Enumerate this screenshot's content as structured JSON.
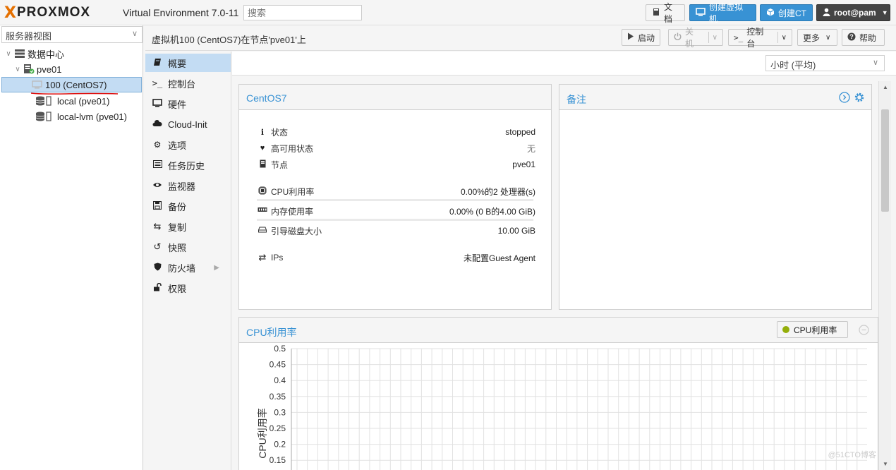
{
  "app": {
    "logo_x": "X",
    "logo_text": "PROXMOX",
    "version": "Virtual Environment 7.0-11",
    "search_placeholder": "搜索"
  },
  "header_buttons": {
    "docs": "文档",
    "create_vm": "创建虚拟机",
    "create_ct": "创建CT",
    "user": "root@pam"
  },
  "tree": {
    "view_selector": "服务器视图",
    "items": [
      {
        "label": "数据中心",
        "icon": "datacenter-icon"
      },
      {
        "label": "pve01",
        "icon": "node-online-icon"
      },
      {
        "label": "100 (CentOS7)",
        "icon": "vm-stopped-icon",
        "selected": true
      },
      {
        "label": "local (pve01)",
        "icon": "storage-icon"
      },
      {
        "label": "local-lvm (pve01)",
        "icon": "storage-icon"
      }
    ]
  },
  "titlebar": {
    "title": "虚拟机100 (CentOS7)在节点'pve01'上",
    "start": "启动",
    "shutdown": "关机",
    "console": "控制台",
    "more": "更多",
    "help": "帮助"
  },
  "nav": [
    {
      "label": "概要",
      "icon": "book-icon",
      "active": true
    },
    {
      "label": "控制台",
      "icon": "terminal-icon"
    },
    {
      "label": "硬件",
      "icon": "desktop-icon"
    },
    {
      "label": "Cloud-Init",
      "icon": "cloud-icon"
    },
    {
      "label": "选项",
      "icon": "gear-icon"
    },
    {
      "label": "任务历史",
      "icon": "list-icon"
    },
    {
      "label": "监视器",
      "icon": "eye-icon"
    },
    {
      "label": "备份",
      "icon": "floppy-icon"
    },
    {
      "label": "复制",
      "icon": "retweet-icon"
    },
    {
      "label": "快照",
      "icon": "history-icon"
    },
    {
      "label": "防火墙",
      "icon": "shield-icon",
      "has_submenu": true
    },
    {
      "label": "权限",
      "icon": "unlock-icon"
    }
  ],
  "timeframe": "小时 (平均)",
  "status": {
    "title": "CentOS7",
    "rows": [
      {
        "label": "状态",
        "value": "stopped",
        "icon": "info-icon"
      },
      {
        "label": "高可用状态",
        "value": "无",
        "icon": "heartbeat-icon"
      },
      {
        "label": "节点",
        "value": "pve01",
        "icon": "server-icon"
      },
      {
        "label": "CPU利用率",
        "value": "0.00%的2 处理器(s)",
        "icon": "cpu-icon"
      },
      {
        "label": "内存使用率",
        "value": "0.00% (0 B的4.00 GiB)",
        "icon": "memory-icon"
      },
      {
        "label": "引导磁盘大小",
        "value": "10.00 GiB",
        "icon": "hdd-icon"
      },
      {
        "label": "IPs",
        "value": "未配置Guest Agent",
        "icon": "exchange-icon"
      }
    ]
  },
  "notes": {
    "title": "备注"
  },
  "cpu_chart": {
    "title": "CPU利用率",
    "legend_label": "CPU利用率"
  },
  "chart_data": {
    "type": "line",
    "title": "CPU利用率",
    "ylabel": "CPU利用率",
    "xlabel": "",
    "ylim": [
      0,
      0.5
    ],
    "y_ticks": [
      "0.5",
      "0.45",
      "0.4",
      "0.35",
      "0.3",
      "0.25",
      "0.2",
      "0.15"
    ],
    "series": [
      {
        "name": "CPU利用率",
        "values": []
      }
    ],
    "legend": "top-right",
    "grid": true,
    "colors": {
      "series": "#94ae0a"
    }
  },
  "watermark": "@51CTO博客",
  "colors": {
    "accent": "#3892d4",
    "brand_orange": "#e57000",
    "selection": "#c3dcf3",
    "status_green": "#4caf50"
  }
}
